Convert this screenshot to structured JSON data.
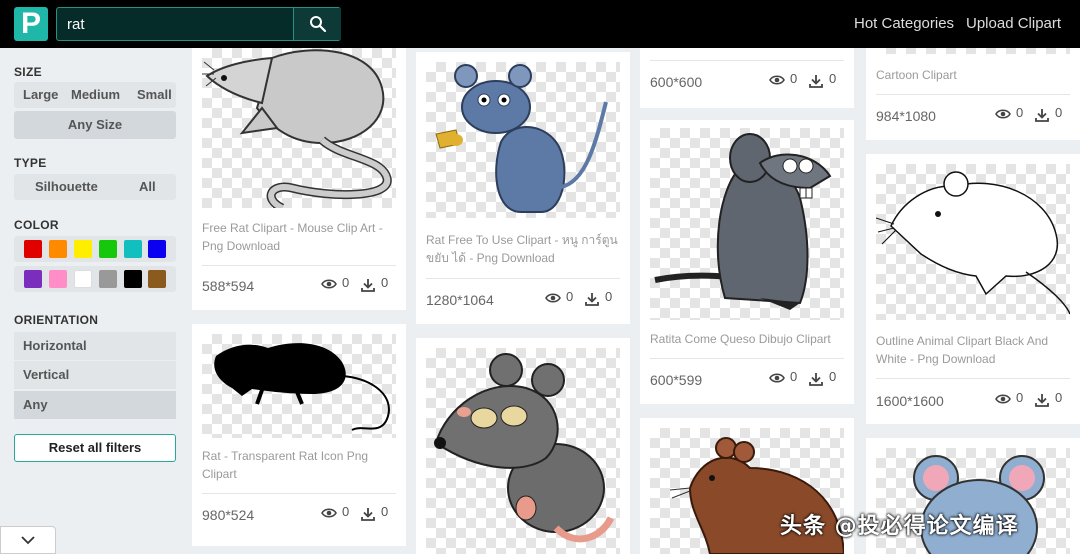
{
  "header": {
    "logo_letter": "P",
    "search_value": "rat",
    "nav": [
      "Hot Categories",
      "Upload Clipart"
    ]
  },
  "sidebar": {
    "size_title": "SIZE",
    "size_options": [
      "Large",
      "Medium",
      "Small"
    ],
    "size_selected": "Any Size",
    "type_title": "TYPE",
    "type_options": [
      "Silhouette",
      "All"
    ],
    "color_title": "COLOR",
    "colors": [
      "#e00000",
      "#ff8a00",
      "#ffee00",
      "#17c70b",
      "#12bfbf",
      "#0b00f0",
      "#7b2dbd",
      "#ff8ec8",
      "#ffffff",
      "#999999",
      "#000000",
      "#8a5a1e"
    ],
    "orientation_title": "ORIENTATION",
    "orientations": [
      "Horizontal",
      "Vertical",
      "Any"
    ],
    "orientation_selected": "Any",
    "reset_label": "Reset all filters"
  },
  "cards": [
    {
      "title": "Free Rat Clipart - Mouse Clip Art - Png Download",
      "dims": "588*594",
      "views": "0",
      "downloads": "0",
      "icon": "gray-rat-clipart"
    },
    {
      "title": "Rat - Transparent Rat Icon Png Clipart",
      "dims": "980*524",
      "views": "0",
      "downloads": "0",
      "icon": "rat-silhouette"
    },
    {
      "title": "Rat Free To Use Clipart - หนู การ์ตูน ขยับ ได้ - Png Download",
      "dims": "1280*1064",
      "views": "0",
      "downloads": "0",
      "icon": "blue-rat-cheese"
    },
    {
      "title": "",
      "dims": "",
      "views": "",
      "downloads": "",
      "icon": "sleepy-rat"
    },
    {
      "title": "",
      "dims": "600*600",
      "views": "0",
      "downloads": "0",
      "icon": "cropped-clipart"
    },
    {
      "title": "Ratita Come Queso Dibujo Clipart",
      "dims": "600*599",
      "views": "0",
      "downloads": "0",
      "icon": "gray-rat-standing"
    },
    {
      "title": "",
      "dims": "",
      "views": "",
      "downloads": "",
      "icon": "brown-rat"
    },
    {
      "title": "Cartoon Clipart",
      "dims": "984*1080",
      "views": "0",
      "downloads": "0",
      "icon": "cropped-clipart"
    },
    {
      "title": "Outline Animal Clipart Black And White - Png Download",
      "dims": "1600*1600",
      "views": "0",
      "downloads": "0",
      "icon": "outline-rat"
    },
    {
      "title": "",
      "dims": "",
      "views": "",
      "downloads": "",
      "icon": "blue-mouse-face"
    }
  ],
  "watermark": "头条 @投必得论文编译"
}
